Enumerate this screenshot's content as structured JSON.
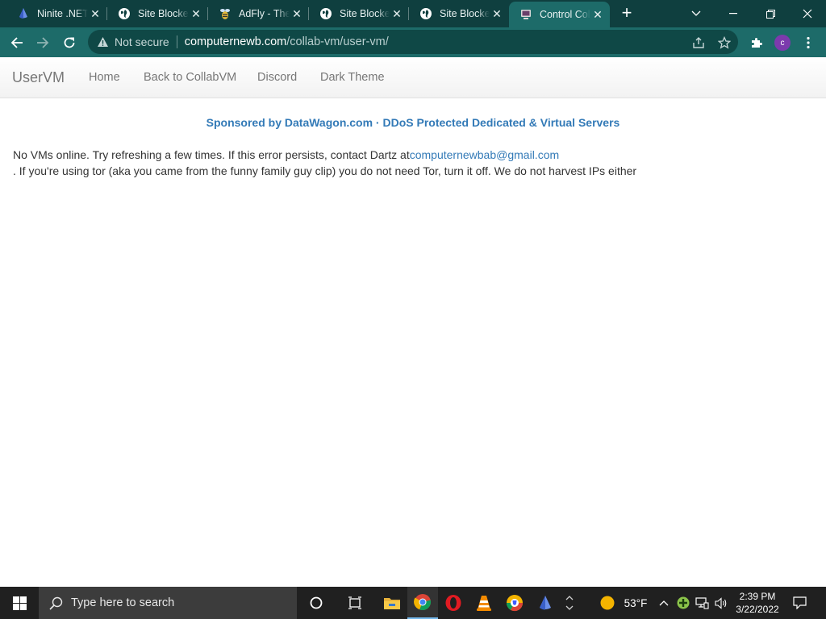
{
  "browser": {
    "tabs": [
      {
        "title": "Ninite .NET",
        "icon": "ninite-icon",
        "active": false
      },
      {
        "title": "Site Blocked",
        "icon": "globe-icon",
        "active": false
      },
      {
        "title": "AdFly - The",
        "icon": "adfly-bee-icon",
        "active": false
      },
      {
        "title": "Site Blocked",
        "icon": "globe-icon",
        "active": false
      },
      {
        "title": "Site Blocked",
        "icon": "globe-icon",
        "active": false
      },
      {
        "title": "Control Col",
        "icon": "collabvm-icon",
        "active": true
      }
    ],
    "new_tab_label": "+",
    "omnibox": {
      "security_label": "Not secure",
      "url_host": "computernewb.com",
      "url_path": "/collab-vm/user-vm/"
    },
    "profile_initial": "c",
    "theme_color": "#1d6b69",
    "tabstrip_color": "#0f3f3f"
  },
  "site": {
    "brand": "UserVM",
    "nav": [
      "Home",
      "Back to CollabVM",
      "Discord",
      "Dark Theme"
    ],
    "sponsor": "Sponsored by DataWagon.com · DDoS Protected Dedicated & Virtual Servers",
    "message_line1_text": "No VMs online. Try refreshing a few times. If this error persists, contact Dartz at",
    "message_email": "computernewbab@gmail.com",
    "message_line2": ". If you're using tor (aka you came from the funny family guy clip) you do not need Tor, turn it off. We do not harvest IPs either",
    "link_color": "#337ab7"
  },
  "taskbar": {
    "search_placeholder": "Type here to search",
    "weather": "53°F",
    "time": "2:39 PM",
    "date": "3/22/2022",
    "apps": [
      "cortana-icon",
      "task-view-icon",
      "file-explorer-icon",
      "chrome-icon",
      "opera-icon",
      "vlc-icon",
      "brave-like-browser-icon",
      "ninite-icon"
    ]
  }
}
